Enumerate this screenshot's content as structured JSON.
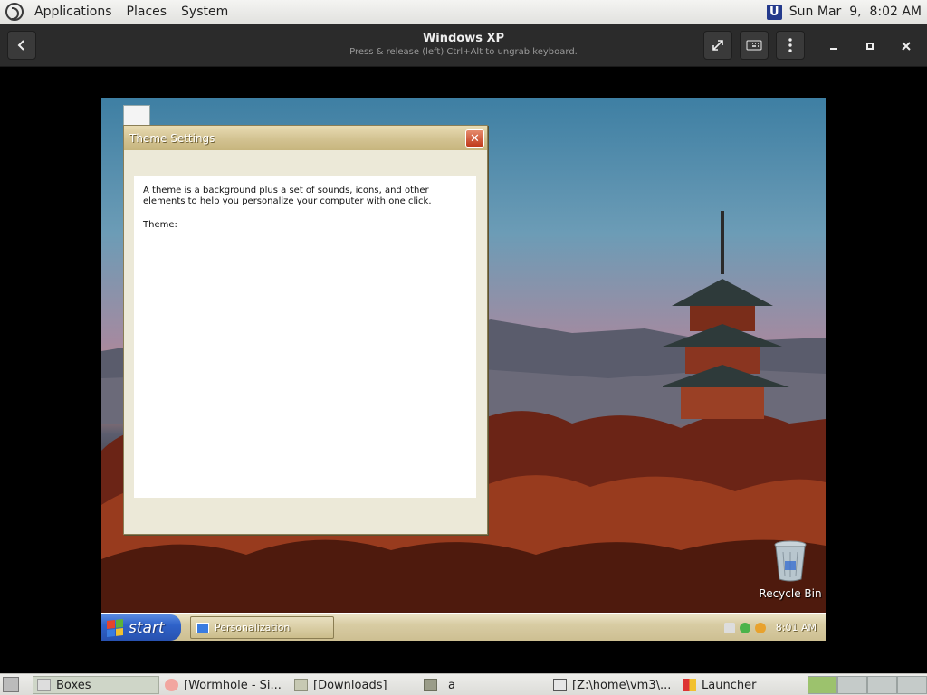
{
  "top_panel": {
    "menus": [
      "Applications",
      "Places",
      "System"
    ],
    "clock": "Sun Mar  9,  8:02 AM",
    "tray_icon": "U"
  },
  "boxes_header": {
    "title": "Windows XP",
    "subtitle": "Press & release (left) Ctrl+Alt to ungrab keyboard.",
    "buttons": [
      "back-icon",
      "fullscreen-icon",
      "keyboard-icon",
      "kebab-menu-icon",
      "minimize-icon",
      "maximize-icon",
      "close-icon"
    ]
  },
  "dialog": {
    "title": "Theme Settings",
    "description": "A theme is a background plus a set of sounds, icons, and other elements to help you personalize your computer with one click.",
    "theme_label": "Theme:"
  },
  "desktop": {
    "recycle_bin_label": "Recycle Bin"
  },
  "xp_taskbar": {
    "start_label": "start",
    "task_label": "Personalization",
    "clock": "8:01 AM"
  },
  "bottom_panel": {
    "tasks": [
      {
        "label": "Boxes",
        "active": true
      },
      {
        "label": "[Wormhole - Si...",
        "active": false
      },
      {
        "label": "[Downloads]",
        "active": false
      },
      {
        "label": "a",
        "active": false
      },
      {
        "label": "[Z:\\home\\vm3\\...",
        "active": false
      },
      {
        "label": "Launcher",
        "active": false
      }
    ],
    "workspaces": 4,
    "active_workspace": 1
  }
}
